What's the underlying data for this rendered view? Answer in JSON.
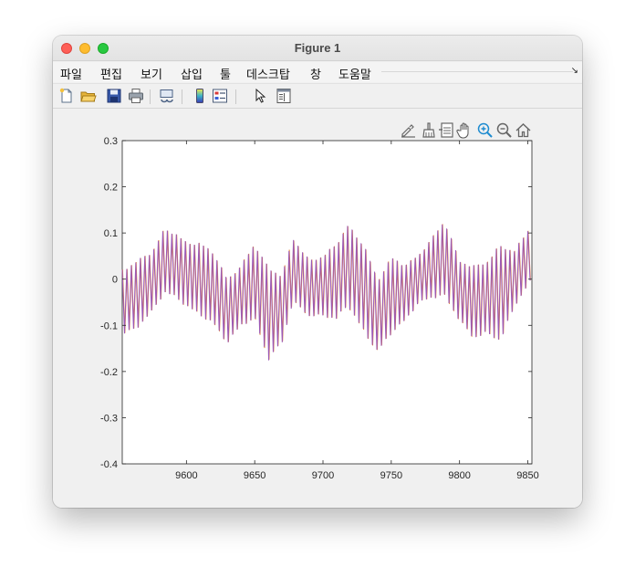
{
  "window": {
    "title": "Figure 1"
  },
  "menubar": {
    "items": [
      "파일",
      "편집",
      "보기",
      "삽입",
      "툴",
      "데스크탑",
      "창",
      "도움말"
    ]
  },
  "toolbar": {
    "icons": [
      "new-figure-icon",
      "open-file-icon",
      "save-icon",
      "print-icon",
      "link-plot-icon",
      "colorbar-icon",
      "legend-icon",
      "edit-plot-arrow-icon",
      "property-inspector-icon"
    ]
  },
  "axes_toolbar": {
    "icons": [
      "data-tips-icon",
      "brush-icon",
      "restore-view-icon",
      "pan-hand-icon",
      "zoom-in-icon",
      "zoom-out-icon",
      "home-icon"
    ]
  },
  "chart_data": {
    "type": "line",
    "title": "",
    "xlabel": "",
    "ylabel": "",
    "xlim": [
      9553,
      9853
    ],
    "ylim": [
      -0.4,
      0.3
    ],
    "xticks": [
      9600,
      9650,
      9700,
      9750,
      9800,
      9850
    ],
    "yticks": [
      0.3,
      0.2,
      0.1,
      0,
      -0.1,
      -0.2,
      -0.3,
      -0.4
    ],
    "ytick_labels": [
      "0.3",
      "0.2",
      "0.1",
      "0",
      "-0.1",
      "-0.2",
      "-0.3",
      "-0.4"
    ],
    "xtick_labels": [
      "9600",
      "9650",
      "9700",
      "9750",
      "9800",
      "9850"
    ],
    "grid": false,
    "series_colors": [
      "#e0803a",
      "#9b59b6"
    ],
    "envelope_top": [
      [
        9553,
        0.03
      ],
      [
        9563,
        0.05
      ],
      [
        9575,
        0.07
      ],
      [
        9584,
        0.12
      ],
      [
        9592,
        0.11
      ],
      [
        9600,
        0.09
      ],
      [
        9610,
        0.09
      ],
      [
        9620,
        0.07
      ],
      [
        9630,
        0.01
      ],
      [
        9640,
        0.04
      ],
      [
        9650,
        0.09
      ],
      [
        9660,
        0.04
      ],
      [
        9670,
        0.02
      ],
      [
        9678,
        0.1
      ],
      [
        9690,
        0.05
      ],
      [
        9700,
        0.06
      ],
      [
        9710,
        0.09
      ],
      [
        9718,
        0.13
      ],
      [
        9730,
        0.09
      ],
      [
        9740,
        0.01
      ],
      [
        9750,
        0.06
      ],
      [
        9760,
        0.04
      ],
      [
        9770,
        0.06
      ],
      [
        9780,
        0.1
      ],
      [
        9789,
        0.14
      ],
      [
        9800,
        0.05
      ],
      [
        9810,
        0.04
      ],
      [
        9820,
        0.05
      ],
      [
        9830,
        0.09
      ],
      [
        9840,
        0.07
      ],
      [
        9853,
        0.13
      ]
    ],
    "envelope_bottom": [
      [
        9553,
        -0.13
      ],
      [
        9563,
        -0.12
      ],
      [
        9575,
        -0.08
      ],
      [
        9584,
        -0.04
      ],
      [
        9592,
        -0.05
      ],
      [
        9600,
        -0.07
      ],
      [
        9610,
        -0.09
      ],
      [
        9620,
        -0.11
      ],
      [
        9630,
        -0.15
      ],
      [
        9640,
        -0.11
      ],
      [
        9650,
        -0.1
      ],
      [
        9660,
        -0.19
      ],
      [
        9670,
        -0.15
      ],
      [
        9678,
        -0.06
      ],
      [
        9690,
        -0.09
      ],
      [
        9700,
        -0.09
      ],
      [
        9710,
        -0.1
      ],
      [
        9718,
        -0.07
      ],
      [
        9730,
        -0.13
      ],
      [
        9740,
        -0.17
      ],
      [
        9750,
        -0.13
      ],
      [
        9760,
        -0.1
      ],
      [
        9770,
        -0.06
      ],
      [
        9780,
        -0.05
      ],
      [
        9789,
        -0.05
      ],
      [
        9800,
        -0.1
      ],
      [
        9810,
        -0.14
      ],
      [
        9820,
        -0.13
      ],
      [
        9830,
        -0.15
      ],
      [
        9840,
        -0.07
      ],
      [
        9853,
        -0.01
      ]
    ],
    "oscillation_period": 3.3
  }
}
